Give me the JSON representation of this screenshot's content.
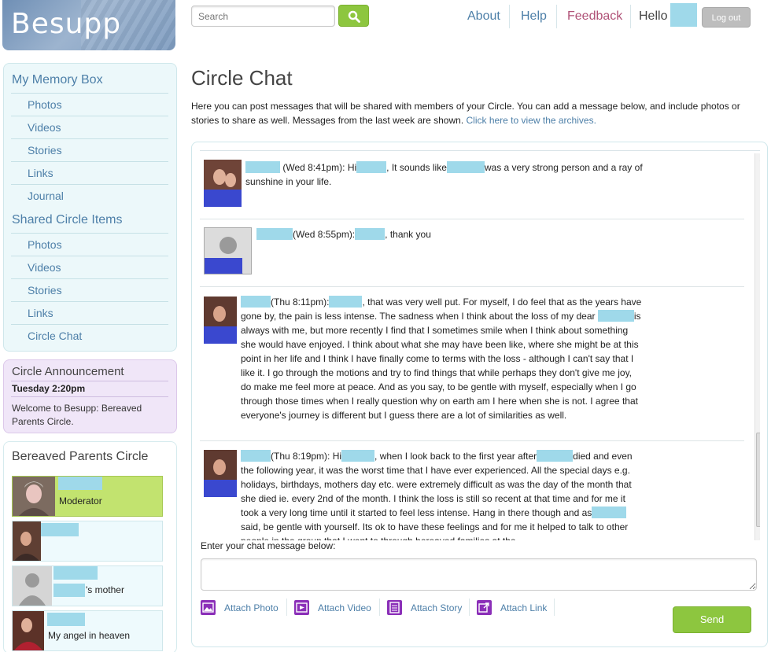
{
  "brand": {
    "logo_text": "Besupp"
  },
  "header": {
    "search_placeholder": "Search",
    "nav": {
      "about": "About",
      "help": "Help",
      "feedback": "Feedback",
      "hello": "Hello"
    },
    "logout_label": "Log out"
  },
  "sidebar": {
    "memory_box": {
      "title": "My Memory Box",
      "items": [
        "Photos",
        "Videos",
        "Stories",
        "Links",
        "Journal"
      ]
    },
    "shared_items": {
      "title": "Shared Circle Items",
      "items": [
        "Photos",
        "Videos",
        "Stories",
        "Links",
        "Circle Chat"
      ]
    },
    "announcement": {
      "title": "Circle Announcement",
      "date": "Tuesday 2:20pm",
      "text": "Welcome to Besupp: Bereaved Parents Circle."
    },
    "circle": {
      "title": "Bereaved Parents Circle",
      "members": [
        {
          "role": "Moderator"
        },
        {
          "role": ""
        },
        {
          "role": "'s mother"
        },
        {
          "role": "My angel in heaven"
        }
      ]
    }
  },
  "main": {
    "title": "Circle Chat",
    "intro": "Here you can post messages that will be shared with members of your Circle. You can add a message below, and include photos or stories to share as well. Messages from the last week are shown.",
    "archive_link": "Click here to view the archives.",
    "messages": [
      {
        "time": "(Wed 8:41pm): Hi",
        "parts": [
          ", It sounds like",
          "was a very strong person and a ray of sunshine in your life."
        ]
      },
      {
        "time": "(Wed 8:55pm):",
        "parts": [
          ", thank you"
        ]
      },
      {
        "time": "(Thu 8:11pm):",
        "parts": [
          ", that was very well put. For myself, I do feel that as the years have gone by, the pain is less intense. The sadness when I think about the loss of my dear",
          "is always with me, but more recently I find that I sometimes smile when I think about something she would have enjoyed. I think about what she may have been like, where she might be at this point in her life and I think I have finally come to terms with the loss - although I can't say that I like it. I go through the motions and try to find things that while perhaps they don't give me joy, do make me feel more at peace. And as you say, to be gentle with myself, especially when I go through those times when I really question why on earth am I here when she is not. I agree that everyone's journey is different but I guess there are a lot of similarities as well."
        ]
      },
      {
        "time": "(Thu 8:19pm): Hi",
        "parts": [
          ", when I look back to the first year after",
          "died and even the following year, it was the worst time that I have ever experienced. All the special days e.g. holidays, birthdays, mothers day etc. were extremely difficult as was the day of the month that she died ie. every 2nd of the month. I think the loss is still so recent at that time and for me it took a very long time until it started to feel less intense. Hang in there though and as",
          "said, be gentle with yourself. Its ok to have these feelings and for me it helped to talk to other people in the group that I went to through bereaved families at the"
        ]
      }
    ],
    "chat_label": "Enter your chat message below:",
    "attachments": [
      "Attach Photo",
      "Attach Video",
      "Attach Story",
      "Attach Link"
    ],
    "send_label": "Send"
  },
  "colors": {
    "accent_green": "#8dc63f",
    "link_blue": "#4d7fa8",
    "feedback_pink": "#b05277",
    "redaction": "#9fd9ea"
  }
}
